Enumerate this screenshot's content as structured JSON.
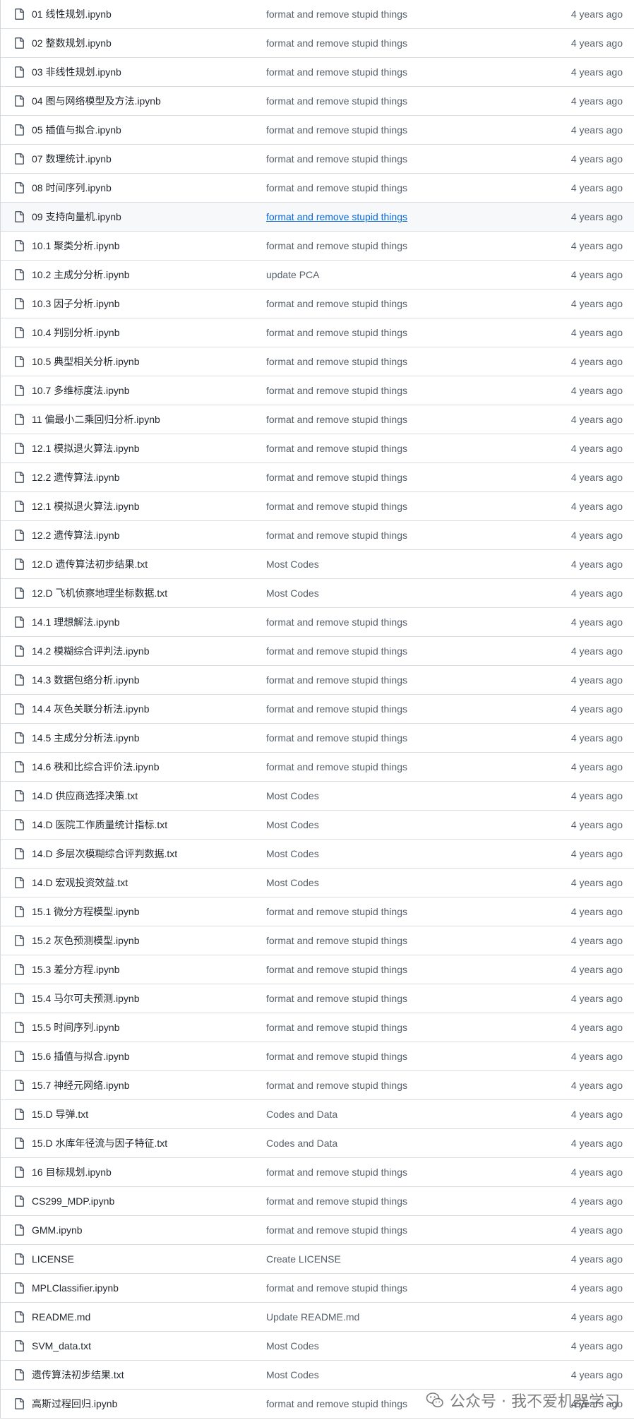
{
  "icons": {
    "file": "file-icon",
    "watermark": "wechat-logo-icon"
  },
  "colors": {
    "link": "#0969da",
    "text": "#24292f",
    "muted": "#57606a",
    "border": "#d0d7de",
    "hover_bg": "#f6f8fa"
  },
  "files": [
    {
      "name": "01 线性规划.ipynb",
      "commit": "format and remove stupid things",
      "age": "4 years ago"
    },
    {
      "name": "02 整数规划.ipynb",
      "commit": "format and remove stupid things",
      "age": "4 years ago"
    },
    {
      "name": "03 非线性规划.ipynb",
      "commit": "format and remove stupid things",
      "age": "4 years ago"
    },
    {
      "name": "04 图与网络模型及方法.ipynb",
      "commit": "format and remove stupid things",
      "age": "4 years ago"
    },
    {
      "name": "05 插值与拟合.ipynb",
      "commit": "format and remove stupid things",
      "age": "4 years ago"
    },
    {
      "name": "07 数理统计.ipynb",
      "commit": "format and remove stupid things",
      "age": "4 years ago"
    },
    {
      "name": "08 时间序列.ipynb",
      "commit": "format and remove stupid things",
      "age": "4 years ago"
    },
    {
      "name": "09 支持向量机.ipynb",
      "commit": "format and remove stupid things",
      "age": "4 years ago",
      "hover": true
    },
    {
      "name": "10.1 聚类分析.ipynb",
      "commit": "format and remove stupid things",
      "age": "4 years ago"
    },
    {
      "name": "10.2 主成分分析.ipynb",
      "commit": "update PCA",
      "age": "4 years ago"
    },
    {
      "name": "10.3 因子分析.ipynb",
      "commit": "format and remove stupid things",
      "age": "4 years ago"
    },
    {
      "name": "10.4 判别分析.ipynb",
      "commit": "format and remove stupid things",
      "age": "4 years ago"
    },
    {
      "name": "10.5 典型相关分析.ipynb",
      "commit": "format and remove stupid things",
      "age": "4 years ago"
    },
    {
      "name": "10.7 多维标度法.ipynb",
      "commit": "format and remove stupid things",
      "age": "4 years ago"
    },
    {
      "name": "11 偏最小二乘回归分析.ipynb",
      "commit": "format and remove stupid things",
      "age": "4 years ago"
    },
    {
      "name": "12.1 模拟退火算法.ipynb",
      "commit": "format and remove stupid things",
      "age": "4 years ago"
    },
    {
      "name": "12.2 遗传算法.ipynb",
      "commit": "format and remove stupid things",
      "age": "4 years ago"
    },
    {
      "name": "12.1 模拟退火算法.ipynb",
      "commit": "format and remove stupid things",
      "age": "4 years ago"
    },
    {
      "name": "12.2 遗传算法.ipynb",
      "commit": "format and remove stupid things",
      "age": "4 years ago"
    },
    {
      "name": "12.D 遗传算法初步结果.txt",
      "commit": "Most Codes",
      "age": "4 years ago"
    },
    {
      "name": "12.D 飞机侦察地理坐标数据.txt",
      "commit": "Most Codes",
      "age": "4 years ago"
    },
    {
      "name": "14.1 理想解法.ipynb",
      "commit": "format and remove stupid things",
      "age": "4 years ago"
    },
    {
      "name": "14.2 模糊综合评判法.ipynb",
      "commit": "format and remove stupid things",
      "age": "4 years ago"
    },
    {
      "name": "14.3 数据包络分析.ipynb",
      "commit": "format and remove stupid things",
      "age": "4 years ago"
    },
    {
      "name": "14.4 灰色关联分析法.ipynb",
      "commit": "format and remove stupid things",
      "age": "4 years ago"
    },
    {
      "name": "14.5 主成分分析法.ipynb",
      "commit": "format and remove stupid things",
      "age": "4 years ago"
    },
    {
      "name": "14.6 秩和比综合评价法.ipynb",
      "commit": "format and remove stupid things",
      "age": "4 years ago"
    },
    {
      "name": "14.D 供应商选择决策.txt",
      "commit": "Most Codes",
      "age": "4 years ago"
    },
    {
      "name": "14.D 医院工作质量统计指标.txt",
      "commit": "Most Codes",
      "age": "4 years ago"
    },
    {
      "name": "14.D 多层次模糊综合评判数据.txt",
      "commit": "Most Codes",
      "age": "4 years ago"
    },
    {
      "name": "14.D 宏观投资效益.txt",
      "commit": "Most Codes",
      "age": "4 years ago"
    },
    {
      "name": "15.1 微分方程模型.ipynb",
      "commit": "format and remove stupid things",
      "age": "4 years ago"
    },
    {
      "name": "15.2 灰色预测模型.ipynb",
      "commit": "format and remove stupid things",
      "age": "4 years ago"
    },
    {
      "name": "15.3 差分方程.ipynb",
      "commit": "format and remove stupid things",
      "age": "4 years ago"
    },
    {
      "name": "15.4 马尔可夫预测.ipynb",
      "commit": "format and remove stupid things",
      "age": "4 years ago"
    },
    {
      "name": "15.5 时间序列.ipynb",
      "commit": "format and remove stupid things",
      "age": "4 years ago"
    },
    {
      "name": "15.6 插值与拟合.ipynb",
      "commit": "format and remove stupid things",
      "age": "4 years ago"
    },
    {
      "name": "15.7 神经元网络.ipynb",
      "commit": "format and remove stupid things",
      "age": "4 years ago"
    },
    {
      "name": "15.D 导弹.txt",
      "commit": "Codes and Data",
      "age": "4 years ago"
    },
    {
      "name": "15.D 水库年径流与因子特征.txt",
      "commit": "Codes and Data",
      "age": "4 years ago"
    },
    {
      "name": "16 目标规划.ipynb",
      "commit": "format and remove stupid things",
      "age": "4 years ago"
    },
    {
      "name": "CS299_MDP.ipynb",
      "commit": "format and remove stupid things",
      "age": "4 years ago"
    },
    {
      "name": "GMM.ipynb",
      "commit": "format and remove stupid things",
      "age": "4 years ago"
    },
    {
      "name": "LICENSE",
      "commit": "Create LICENSE",
      "age": "4 years ago"
    },
    {
      "name": "MPLClassifier.ipynb",
      "commit": "format and remove stupid things",
      "age": "4 years ago"
    },
    {
      "name": "README.md",
      "commit": "Update README.md",
      "age": "4 years ago"
    },
    {
      "name": "SVM_data.txt",
      "commit": "Most Codes",
      "age": "4 years ago"
    },
    {
      "name": "遗传算法初步结果.txt",
      "commit": "Most Codes",
      "age": "4 years ago"
    },
    {
      "name": "高斯过程回归.ipynb",
      "commit": "format and remove stupid things",
      "age": "4 years ago"
    }
  ],
  "watermark": {
    "text": "公众号 · 我不爱机器学习"
  }
}
